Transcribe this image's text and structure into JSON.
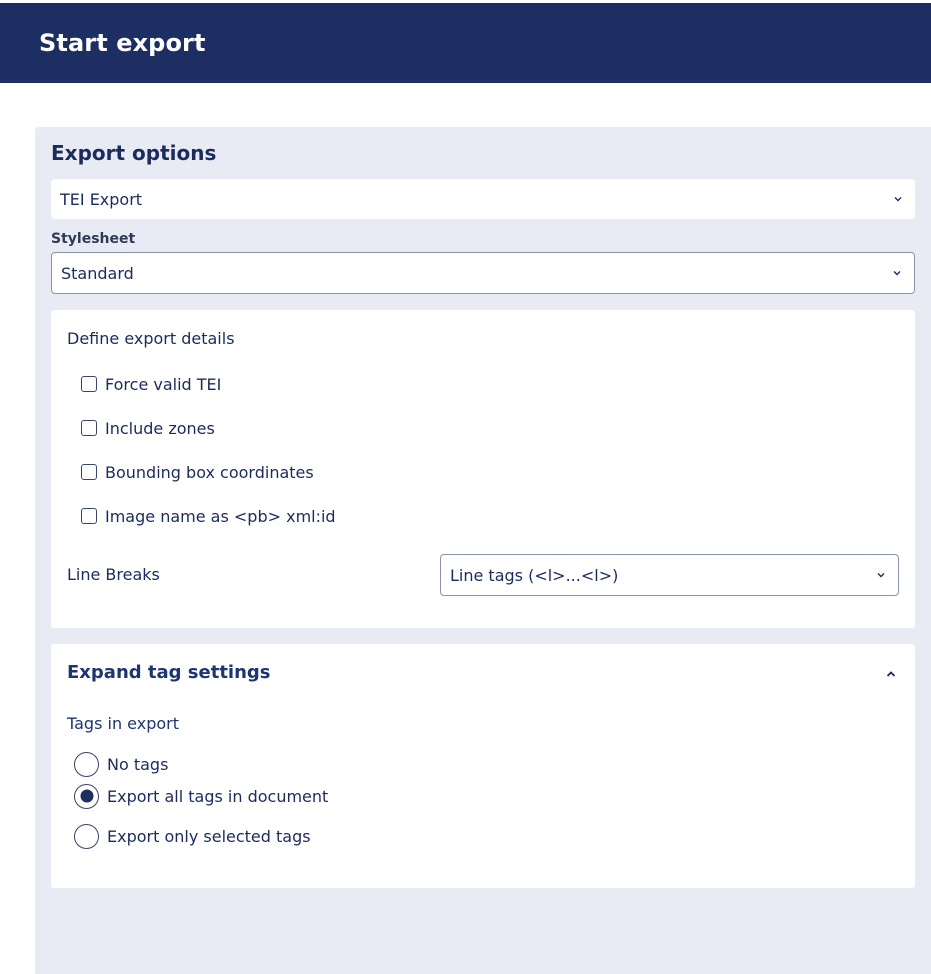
{
  "header": {
    "title": "Start export"
  },
  "export_options": {
    "title": "Export options",
    "format_select": {
      "value": "TEI Export",
      "icon": "chevron-down-icon"
    },
    "stylesheet": {
      "label": "Stylesheet",
      "value": "Standard",
      "icon": "chevron-down-icon"
    }
  },
  "details": {
    "heading": "Define export details",
    "checkboxes": [
      {
        "label": "Force valid TEI",
        "checked": false
      },
      {
        "label": "Include zones",
        "checked": false
      },
      {
        "label": "Bounding box coordinates",
        "checked": false
      },
      {
        "label": "Image name as <pb> xml:id",
        "checked": false
      }
    ],
    "line_breaks": {
      "label": "Line Breaks",
      "value": "Line tags (<l>...<l>)",
      "icon": "chevron-down-icon"
    }
  },
  "tags": {
    "expand_title": "Expand tag settings",
    "expand_icon": "chevron-up-icon",
    "group_label": "Tags in export",
    "options": [
      {
        "label": "No tags",
        "selected": false
      },
      {
        "label": "Export all tags in document",
        "selected": true
      },
      {
        "label": "Export only selected tags",
        "selected": false
      }
    ]
  },
  "colors": {
    "header_bg": "#1d2f62",
    "panel_bg": "#e8ebf3",
    "text": "#1b2b5c"
  }
}
